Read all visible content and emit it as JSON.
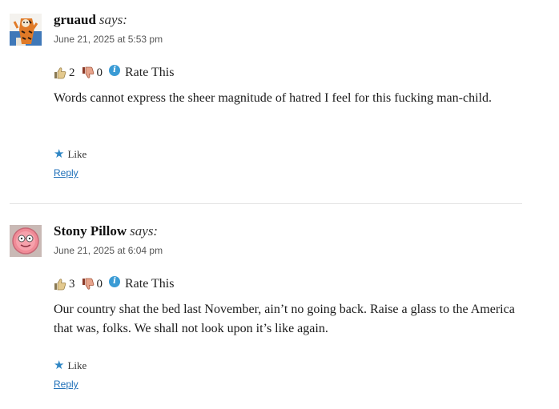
{
  "comments": [
    {
      "author": "gruaud",
      "says": "says:",
      "date": "June 21, 2025 at 5:53 pm",
      "thumbs_up": "2",
      "thumbs_down": "0",
      "rate_label": "Rate This",
      "text": "Words cannot express the sheer magnitude of hatred I feel for this fucking man-child.",
      "like_label": "Like",
      "reply_label": "Reply",
      "avatar_icon": "avatar-cartoon-tiger"
    },
    {
      "author": "Stony Pillow",
      "says": "says:",
      "date": "June 21, 2025 at 6:04 pm",
      "thumbs_up": "3",
      "thumbs_down": "0",
      "rate_label": "Rate This",
      "text": "Our country shat the bed last November, ain’t no going back. Raise a glass to the America that was, folks. We shall not look upon it’s like again.",
      "like_label": "Like",
      "reply_label": "Reply",
      "avatar_icon": "avatar-pink-face"
    }
  ],
  "colors": {
    "link": "#1e6fb8",
    "star": "#2f86c4",
    "info": "#3a9bd5",
    "divider": "#e3e3e3"
  }
}
